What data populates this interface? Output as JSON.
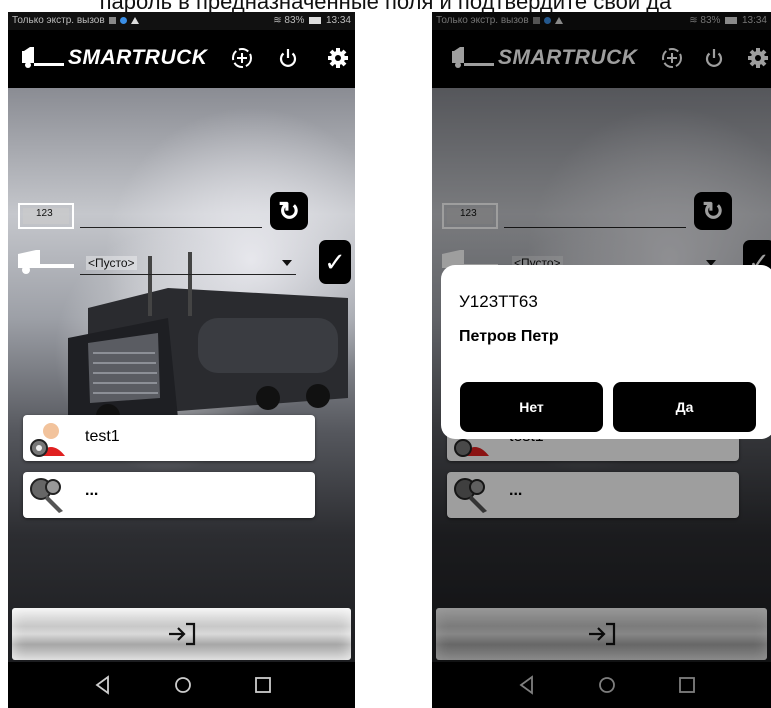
{
  "caption": "пароль в предназначенные поля и подтвердите свой да",
  "status_bar": {
    "left_text": "Только экстр. вызов",
    "battery": "83%",
    "time_left": "13:34",
    "time_right": "13:34"
  },
  "header": {
    "logo_text": "SMARTRUCK",
    "icons": [
      "sync-icon",
      "power-icon",
      "gear-icon"
    ]
  },
  "form": {
    "plate_placeholder": "123",
    "vehicle_select_value": "<Пусто>"
  },
  "list": {
    "driver_name": "test1",
    "password_mask": "..."
  },
  "login_button": {
    "icon": "login-arrow-icon"
  },
  "dialog": {
    "title": "У123ТТ63",
    "subtitle": "Петров Петр",
    "no_label": "Нет",
    "yes_label": "Да"
  },
  "navbar": {
    "icons": [
      "back-icon",
      "home-icon",
      "recents-icon"
    ]
  },
  "colors": {
    "header": "#000000",
    "button": "#000000",
    "dialog_bg": "#ffffff"
  }
}
